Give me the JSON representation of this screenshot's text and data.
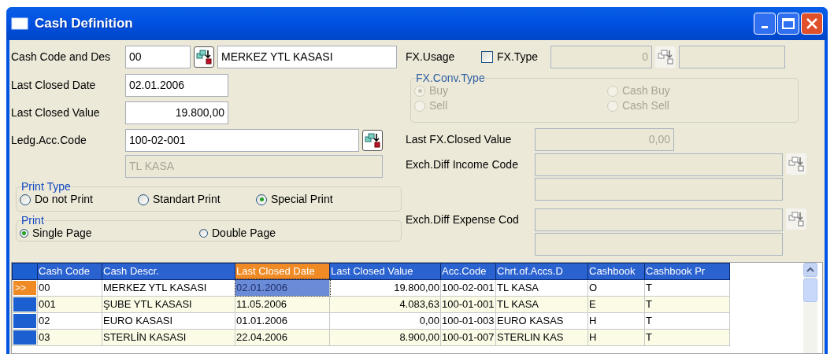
{
  "window": {
    "title": "Cash Definition"
  },
  "cash_code": {
    "label": "Cash Code and Des",
    "code": "00",
    "description": "MERKEZ YTL KASASI"
  },
  "last_closed_date": {
    "label": "Last Closed Date",
    "value": "02.01.2006"
  },
  "last_closed_value": {
    "label": "Last Closed Value",
    "value": "19.800,00"
  },
  "ledger_account": {
    "label": "Ledg.Acc.Code",
    "code": "100-02-001",
    "description": "TL KASA",
    "description_disabled": true
  },
  "print_type": {
    "legend": "Print Type",
    "options": [
      {
        "label": "Do not Print",
        "selected": false
      },
      {
        "label": "Standart Print",
        "selected": false
      },
      {
        "label": "Special Print",
        "selected": true
      }
    ]
  },
  "print": {
    "legend": "Print",
    "options": [
      {
        "label": "Single Page",
        "selected": true
      },
      {
        "label": "Double Page",
        "selected": false
      }
    ]
  },
  "fx_usage": {
    "label": "FX.Usage"
  },
  "fx_type": {
    "label": "FX.Type",
    "checked": false,
    "value": "0",
    "disabled": true
  },
  "fx_conv_type": {
    "legend": "FX.Conv.Type",
    "disabled": true,
    "options": [
      {
        "label": "Buy",
        "selected": true
      },
      {
        "label": "Cash Buy",
        "selected": false
      },
      {
        "label": "Sell",
        "selected": false
      },
      {
        "label": "Cash Sell",
        "selected": false
      }
    ]
  },
  "last_fx_closed_value": {
    "label": "Last FX.Closed Value",
    "value": "0,00",
    "disabled": true
  },
  "exch_diff_income": {
    "label": "Exch.Diff Income Code",
    "disabled": true
  },
  "exch_diff_expense": {
    "label": "Exch.Diff Expense Cod",
    "disabled": true
  },
  "table": {
    "columns": [
      {
        "label": "Cash Code",
        "sorted": false,
        "kind": "text"
      },
      {
        "label": "Cash Descr.",
        "sorted": false,
        "kind": "text"
      },
      {
        "label": "Last Closed Date",
        "sorted": true,
        "kind": "text"
      },
      {
        "label": "Last Closed Value",
        "sorted": false,
        "kind": "amount"
      },
      {
        "label": "Acc.Code",
        "sorted": false,
        "kind": "text"
      },
      {
        "label": "Chrt.of.Accs.D",
        "sorted": false,
        "kind": "text"
      },
      {
        "label": "Cashbook",
        "sorted": false,
        "kind": "text"
      },
      {
        "label": "Cashbook Pr",
        "sorted": false,
        "kind": "text"
      }
    ],
    "rows": [
      {
        "selected": true,
        "indicator": ">>",
        "cells": [
          "00",
          "MERKEZ YTL KASASI",
          "02.01.2006",
          "19.800,00",
          "100-02-001",
          "TL KASA",
          "O",
          "T"
        ]
      },
      {
        "selected": false,
        "cells": [
          "001",
          "ŞUBE YTL KASASI",
          "11.05.2006",
          "4.083,63",
          "100-01-001",
          "TL KASA",
          "E",
          "T"
        ]
      },
      {
        "selected": false,
        "cells": [
          "02",
          "EURO KASASI",
          "01.01.2006",
          "0,00",
          "100-01-003",
          "EURO KASAS",
          "H",
          "T"
        ]
      },
      {
        "selected": false,
        "cells": [
          "03",
          "STERLİN KASASI",
          "22.04.2006",
          "8.900,00",
          "100-01-007",
          "STERLIN KAS",
          "H",
          "T"
        ]
      }
    ]
  }
}
